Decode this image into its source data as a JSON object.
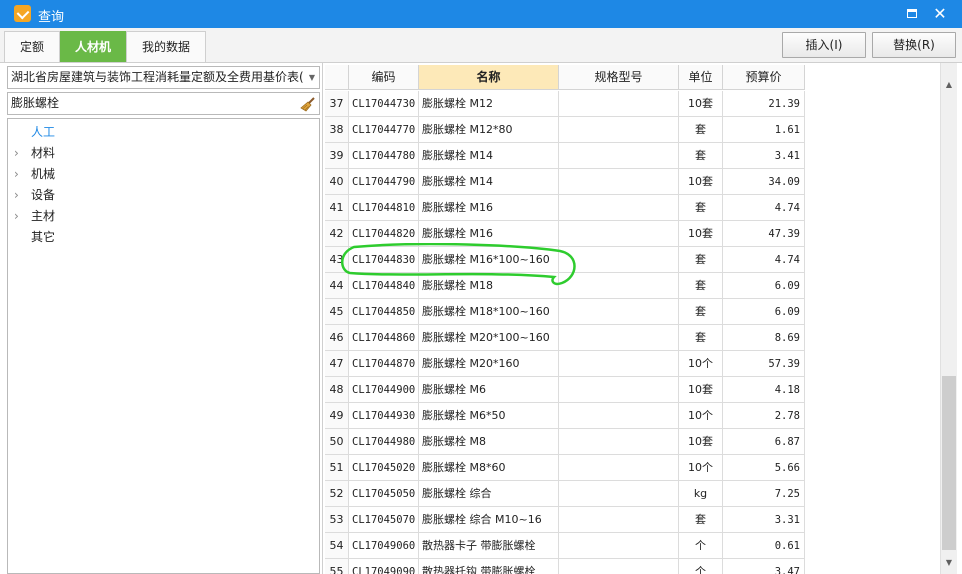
{
  "window": {
    "title": "查询",
    "minimize_label": "",
    "close_label": "✕"
  },
  "tabs": [
    {
      "label": "定额"
    },
    {
      "label": "人材机"
    },
    {
      "label": "我的数据"
    }
  ],
  "actions": {
    "insert_label": "插入(I)",
    "replace_label": "替换(R)"
  },
  "left": {
    "library": "湖北省房屋建筑与装饰工程消耗量定额及全费用基价表(",
    "search_value": "膨胀螺栓",
    "tree": [
      {
        "label": "人工",
        "expandable": false,
        "selected": true
      },
      {
        "label": "材料",
        "expandable": true,
        "selected": false
      },
      {
        "label": "机械",
        "expandable": true,
        "selected": false
      },
      {
        "label": "设备",
        "expandable": true,
        "selected": false
      },
      {
        "label": "主材",
        "expandable": true,
        "selected": false
      },
      {
        "label": "其它",
        "expandable": false,
        "selected": false
      }
    ]
  },
  "grid": {
    "headers": {
      "code": "编码",
      "name": "名称",
      "spec": "规格型号",
      "unit": "单位",
      "price": "预算价"
    },
    "sorted_column": "name",
    "highlighted_row": "43",
    "rows": [
      {
        "num": "37",
        "code": "CL17044730",
        "name": "膨胀螺栓 M12",
        "spec": "",
        "unit": "10套",
        "price": "21.39"
      },
      {
        "num": "38",
        "code": "CL17044770",
        "name": "膨胀螺栓 M12*80",
        "spec": "",
        "unit": "套",
        "price": "1.61"
      },
      {
        "num": "39",
        "code": "CL17044780",
        "name": "膨胀螺栓 M14",
        "spec": "",
        "unit": "套",
        "price": "3.41"
      },
      {
        "num": "40",
        "code": "CL17044790",
        "name": "膨胀螺栓 M14",
        "spec": "",
        "unit": "10套",
        "price": "34.09"
      },
      {
        "num": "41",
        "code": "CL17044810",
        "name": "膨胀螺栓 M16",
        "spec": "",
        "unit": "套",
        "price": "4.74"
      },
      {
        "num": "42",
        "code": "CL17044820",
        "name": "膨胀螺栓 M16",
        "spec": "",
        "unit": "10套",
        "price": "47.39"
      },
      {
        "num": "43",
        "code": "CL17044830",
        "name": "膨胀螺栓 M16*100~160",
        "spec": "",
        "unit": "套",
        "price": "4.74"
      },
      {
        "num": "44",
        "code": "CL17044840",
        "name": "膨胀螺栓 M18",
        "spec": "",
        "unit": "套",
        "price": "6.09"
      },
      {
        "num": "45",
        "code": "CL17044850",
        "name": "膨胀螺栓 M18*100~160",
        "spec": "",
        "unit": "套",
        "price": "6.09"
      },
      {
        "num": "46",
        "code": "CL17044860",
        "name": "膨胀螺栓 M20*100~160",
        "spec": "",
        "unit": "套",
        "price": "8.69"
      },
      {
        "num": "47",
        "code": "CL17044870",
        "name": "膨胀螺栓 M20*160",
        "spec": "",
        "unit": "10个",
        "price": "57.39"
      },
      {
        "num": "48",
        "code": "CL17044900",
        "name": "膨胀螺栓 M6",
        "spec": "",
        "unit": "10套",
        "price": "4.18"
      },
      {
        "num": "49",
        "code": "CL17044930",
        "name": "膨胀螺栓 M6*50",
        "spec": "",
        "unit": "10个",
        "price": "2.78"
      },
      {
        "num": "50",
        "code": "CL17044980",
        "name": "膨胀螺栓 M8",
        "spec": "",
        "unit": "10套",
        "price": "6.87"
      },
      {
        "num": "51",
        "code": "CL17045020",
        "name": "膨胀螺栓 M8*60",
        "spec": "",
        "unit": "10个",
        "price": "5.66"
      },
      {
        "num": "52",
        "code": "CL17045050",
        "name": "膨胀螺栓 综合",
        "spec": "",
        "unit": "kg",
        "price": "7.25"
      },
      {
        "num": "53",
        "code": "CL17045070",
        "name": "膨胀螺栓 综合 M10~16",
        "spec": "",
        "unit": "套",
        "price": "3.31"
      },
      {
        "num": "54",
        "code": "CL17049060",
        "name": "散热器卡子 带膨胀螺栓",
        "spec": "",
        "unit": "个",
        "price": "0.61"
      },
      {
        "num": "55",
        "code": "CL17049090",
        "name": "散热器托钩 带膨胀螺栓",
        "spec": "",
        "unit": "个",
        "price": "3.47"
      }
    ]
  },
  "colors": {
    "titlebar": "#1e88e5",
    "active_tab": "#6ab947",
    "sorted_header": "#fde9b8",
    "annotation": "#2ecc2e"
  }
}
